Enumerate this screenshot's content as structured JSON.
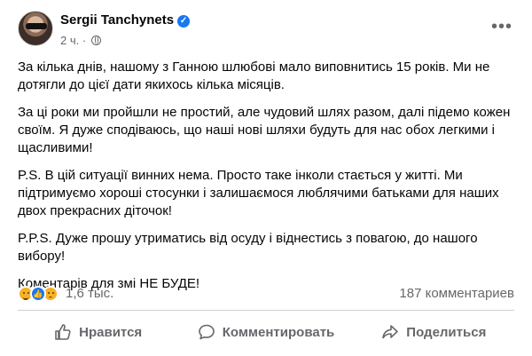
{
  "post": {
    "author": "Sergii Tanchynets",
    "time": "2 ч.",
    "paragraphs": [
      "За кілька днів, нашому з Ганною шлюбові мало виповнитись 15 років. Ми не дотягли до цієї дати якихось кілька місяців.",
      "За ці роки ми пройшли не простий, але чудовий шлях разом, далі підемо кожен своїм. Я дуже сподіваюсь, що наші нові шляхи будуть для нас обох легкими і щасливими!",
      "P.S. В цій ситуації винних нема. Просто таке інколи стається у житті. Ми підтримуємо хороші стосунки і залишаємося люблячими батьками для наших двох прекрасних діточок!",
      "P.P.S. Дуже прошу утриматись від осуду і віднестись з повагою, до нашого вибору!",
      "Коментарів для змі НЕ БУДЕ!"
    ]
  },
  "stats": {
    "reactions_count": "1,6 тыс.",
    "comments_count": "187 комментариев"
  },
  "actions": {
    "like": "Нравится",
    "comment": "Комментировать",
    "share": "Поделиться"
  },
  "icons": {
    "verified": "verified-badge-icon",
    "audience": "globe-icon",
    "more": "more-options-icon",
    "reactions": [
      "haha-reaction-icon",
      "like-reaction-icon",
      "sad-reaction-icon"
    ]
  },
  "colors": {
    "accent": "#1877f2",
    "secondary_text": "#65676b",
    "text": "#050505"
  }
}
